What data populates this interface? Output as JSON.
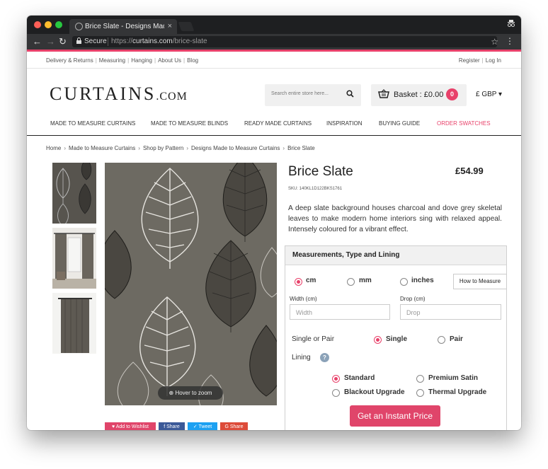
{
  "browser": {
    "tab_title": "Brice Slate - Designs Made to",
    "tab_close": "×",
    "secure_label": "Secure",
    "url_scheme": "https://",
    "url_host": "curtains.com",
    "url_path": "/brice-slate"
  },
  "topbar": {
    "left_links": [
      "Delivery & Returns",
      "Measuring",
      "Hanging",
      "About Us",
      "Blog"
    ],
    "right_links": [
      "Register",
      "Log In"
    ]
  },
  "header": {
    "logo_main": "CURTAINS",
    "logo_suffix": ".COM",
    "search_placeholder": "Search entire store here...",
    "basket_label": "Basket : £0.00",
    "basket_count": "0",
    "currency": "£ GBP"
  },
  "nav": {
    "items": [
      "MADE TO MEASURE CURTAINS",
      "MADE TO MEASURE BLINDS",
      "READY MADE CURTAINS",
      "INSPIRATION",
      "BUYING GUIDE",
      "ORDER SWATCHES"
    ]
  },
  "breadcrumb": [
    "Home",
    "Made to Measure Curtains",
    "Shop by Pattern",
    "Designs Made to Measure Curtains",
    "Brice Slate"
  ],
  "gallery": {
    "zoom_hint": "Hover to zoom",
    "share_buttons": [
      "Add to Wishlist",
      "Share",
      "Tweet",
      "Share"
    ]
  },
  "product": {
    "title": "Brice Slate",
    "price": "£54.99",
    "sku": "SKU: 140KL1D122BKS1761",
    "description": "A deep slate background houses charcoal and dove grey skeletal leaves to make modern home interiors sing with relaxed appeal. Intensely coloured for a vibrant effect."
  },
  "options": {
    "heading": "Measurements, Type and Lining",
    "units": [
      "cm",
      "mm",
      "inches"
    ],
    "how_to_measure": "How to Measure",
    "width_label": "Width (cm)",
    "width_placeholder": "Width",
    "drop_label": "Drop (cm)",
    "drop_placeholder": "Drop",
    "single_pair_label": "Single or Pair",
    "single": "Single",
    "pair": "Pair",
    "lining_label": "Lining",
    "lining_help": "?",
    "linings": [
      "Standard",
      "Premium Satin",
      "Blackout Upgrade",
      "Thermal Upgrade"
    ],
    "cta": "Get an Instant Price"
  },
  "colors": {
    "accent": "#e8416a",
    "chrome": "#1e1f21"
  }
}
